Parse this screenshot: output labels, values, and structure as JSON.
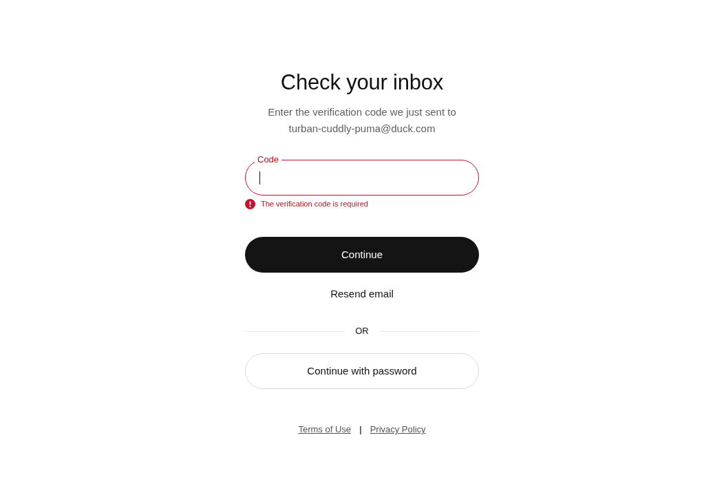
{
  "heading": "Check your inbox",
  "instructions": {
    "text": "Enter the verification code we just sent to",
    "email": "turban-cuddly-puma@duck.com"
  },
  "code_field": {
    "label": "Code",
    "invalid": true,
    "focused": true,
    "error": "The verification code is required"
  },
  "primary_button": "Continue",
  "resend_link": "Resend email",
  "divider": "OR",
  "secondary_button": "Continue with password",
  "footer": {
    "links": [
      "Terms of Use",
      "Privacy Policy"
    ],
    "separator": "|"
  }
}
